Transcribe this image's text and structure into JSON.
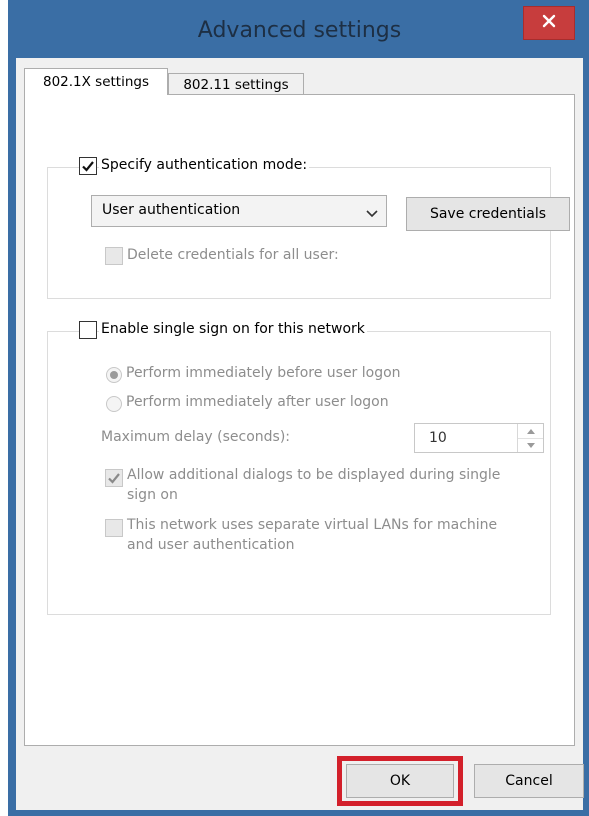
{
  "window": {
    "title": "Advanced settings",
    "close_icon": "close-icon"
  },
  "tabs": [
    {
      "label": "802.1X settings",
      "selected": true
    },
    {
      "label": "802.11 settings",
      "selected": false
    }
  ],
  "auth_group": {
    "specify_label": "Specify authentication mode:",
    "specify_checked": true,
    "mode_value": "User authentication",
    "save_credentials_label": "Save credentials",
    "delete_credentials_label": "Delete credentials for all user:",
    "delete_credentials_checked": false
  },
  "sso_group": {
    "enable_label": "Enable single sign on for this network",
    "enable_checked": false,
    "radio_before_label": "Perform immediately before user logon",
    "radio_before_selected": true,
    "radio_after_label": "Perform immediately after user logon",
    "max_delay_label": "Maximum delay (seconds):",
    "max_delay_value": "10",
    "allow_dialogs_label_line1": "Allow additional dialogs to be displayed during single",
    "allow_dialogs_label_line2": "sign on",
    "allow_dialogs_checked": true,
    "vlan_label_line1": "This network uses separate virtual LANs for machine",
    "vlan_label_line2": "and user authentication",
    "vlan_checked": false
  },
  "footer": {
    "ok_label": "OK",
    "cancel_label": "Cancel"
  },
  "colors": {
    "window_frame": "#3a6ea5",
    "close_button": "#c73d3d",
    "highlight": "#d3202b"
  }
}
